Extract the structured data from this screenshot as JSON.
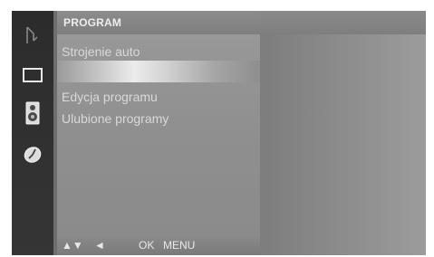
{
  "menu": {
    "title": "PROGRAM",
    "items": [
      "Strojenie auto",
      "",
      "Edycja programu",
      "Ulubione programy"
    ]
  },
  "footer": {
    "up_down": "▲▼",
    "left": "◄",
    "ok": "OK",
    "menu": "MENU"
  },
  "icons": [
    "antenna-icon",
    "screen-icon",
    "speaker-icon",
    "clock-icon"
  ]
}
